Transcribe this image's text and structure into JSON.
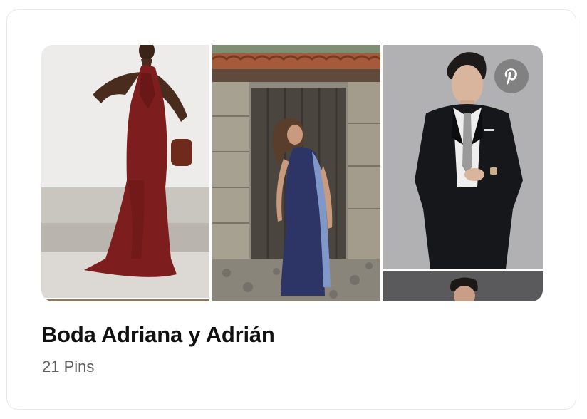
{
  "board": {
    "title": "Boda Adriana y Adrián",
    "pin_count": "21 Pins"
  },
  "icons": {
    "badge": "pinterest-icon"
  },
  "colors": {
    "title_text": "#111111",
    "secondary_text": "#5f5f5f",
    "card_border": "#e9e9e9",
    "badge_background": "#5a5a5a"
  }
}
